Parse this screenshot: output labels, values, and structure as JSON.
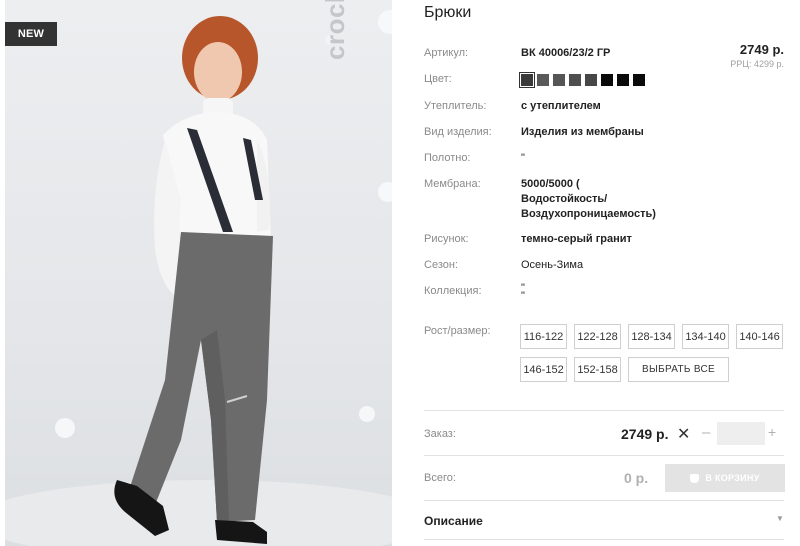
{
  "badge": {
    "new": "NEW"
  },
  "brand": {
    "logo_text": "crockid"
  },
  "product": {
    "title": "Брюки",
    "price": "2749 р.",
    "rrp": "РРЦ: 4299 р.",
    "colors": [
      "#3a3a3a",
      "#595959",
      "#555555",
      "#4e4e4e",
      "#474747",
      "#0a0a0a",
      "#0a0a0a",
      "#0a0a0a"
    ],
    "attributes": [
      {
        "label": "Артикул:",
        "value": "ВК 40006/23/2 ГР"
      },
      {
        "label": "Цвет:",
        "value": ""
      },
      {
        "label": "Утеплитель:",
        "value": "с утеплителем"
      },
      {
        "label": "Вид изделия:",
        "value": "Изделия из мембраны"
      },
      {
        "label": "Полотно:",
        "value": "\""
      },
      {
        "label": "Мембрана:",
        "value": "5000/5000 (",
        "value2": "Водостойкость/",
        "value3": "Воздухопроницаемость)"
      },
      {
        "label": "Рисунок:",
        "value": "темно-серый гранит"
      },
      {
        "label": "Сезон:",
        "value": "Осень-Зима"
      },
      {
        "label": "Коллекция:",
        "value": "\"",
        "value2": "\""
      }
    ],
    "sizes_label": "Рост/размер:",
    "sizes": [
      "116-122",
      "122-128",
      "128-134",
      "134-140",
      "140-146",
      "146-152",
      "152-158"
    ],
    "select_all": "ВЫБРАТЬ ВСЕ"
  },
  "order": {
    "label": "Заказ:",
    "price": "2749 р.",
    "remove": "✕",
    "minus": "–",
    "plus": "+",
    "qty_value": ""
  },
  "total": {
    "label": "Всего:",
    "sum": "0 р.",
    "cart_button": "В КОРЗИНУ"
  },
  "description": {
    "label": "Описание",
    "chevron": "▼"
  }
}
